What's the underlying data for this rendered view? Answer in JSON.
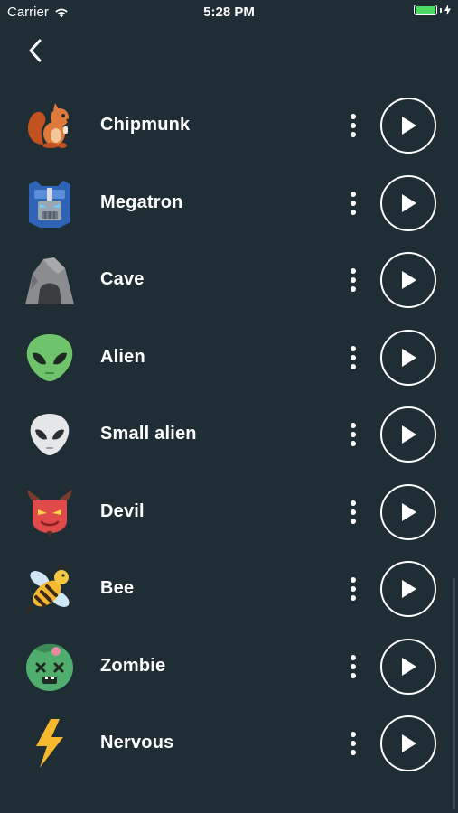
{
  "status_bar": {
    "carrier": "Carrier",
    "time": "5:28 PM"
  },
  "nav": {
    "back_icon": "chevron-left-icon"
  },
  "sounds": [
    {
      "name": "Chipmunk",
      "icon": "squirrel-icon"
    },
    {
      "name": "Megatron",
      "icon": "robot-icon"
    },
    {
      "name": "Cave",
      "icon": "cave-icon"
    },
    {
      "name": "Alien",
      "icon": "green-alien-icon"
    },
    {
      "name": "Small alien",
      "icon": "grey-alien-icon"
    },
    {
      "name": "Devil",
      "icon": "devil-icon"
    },
    {
      "name": "Bee",
      "icon": "bee-icon"
    },
    {
      "name": "Zombie",
      "icon": "zombie-icon"
    },
    {
      "name": "Nervous",
      "icon": "lightning-icon"
    }
  ],
  "colors": {
    "background": "#1f2d35",
    "battery": "#4cd964"
  }
}
